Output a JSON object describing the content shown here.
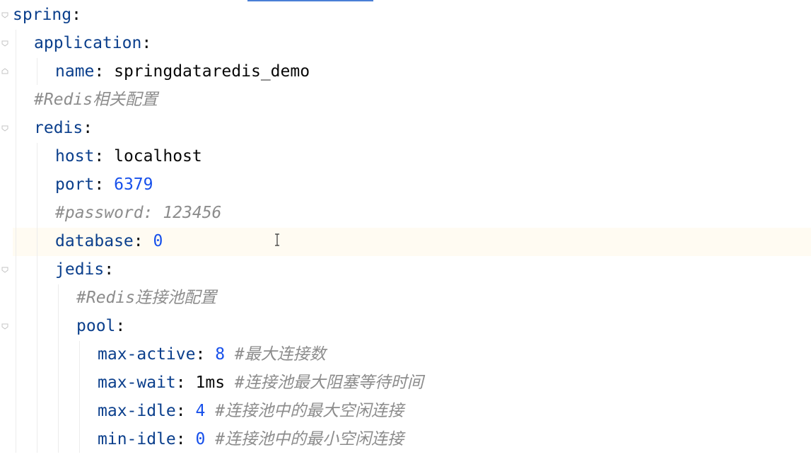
{
  "editor": {
    "lines": [
      {
        "key": "spring",
        "sep": ":",
        "value": "",
        "comment": ""
      },
      {
        "key": "application",
        "sep": ":",
        "value": "",
        "comment": ""
      },
      {
        "key": "name",
        "sep": ":",
        "value": "springdataredis_demo",
        "comment": ""
      },
      {
        "key": "",
        "sep": "",
        "value": "",
        "comment": "#Redis相关配置"
      },
      {
        "key": "redis",
        "sep": ":",
        "value": "",
        "comment": ""
      },
      {
        "key": "host",
        "sep": ":",
        "value": "localhost",
        "comment": ""
      },
      {
        "key": "port",
        "sep": ":",
        "value": "6379",
        "comment": ""
      },
      {
        "key": "",
        "sep": "",
        "value": "",
        "comment": "#password: 123456"
      },
      {
        "key": "database",
        "sep": ":",
        "value": "0",
        "comment": ""
      },
      {
        "key": "jedis",
        "sep": ":",
        "value": "",
        "comment": ""
      },
      {
        "key": "",
        "sep": "",
        "value": "",
        "comment": "#Redis连接池配置"
      },
      {
        "key": "pool",
        "sep": ":",
        "value": "",
        "comment": ""
      },
      {
        "key": "max-active",
        "sep": ":",
        "value": "8",
        "comment": "#最大连接数"
      },
      {
        "key": "max-wait",
        "sep": ":",
        "value": "1ms",
        "comment": "#连接池最大阻塞等待时间"
      },
      {
        "key": "max-idle",
        "sep": ":",
        "value": "4",
        "comment": "#连接池中的最大空闲连接"
      },
      {
        "key": "min-idle",
        "sep": ":",
        "value": "0",
        "comment": "#连接池中的最小空闲连接"
      }
    ],
    "current_line_number": 9,
    "cursor_icon": "text-cursor-icon"
  },
  "colors": {
    "key": "#0b3f8c",
    "number": "#1750eb",
    "comment": "#8c8c8c",
    "plain": "#080808",
    "current_line": "#fffbf2",
    "accent": "#4a7fd6"
  }
}
